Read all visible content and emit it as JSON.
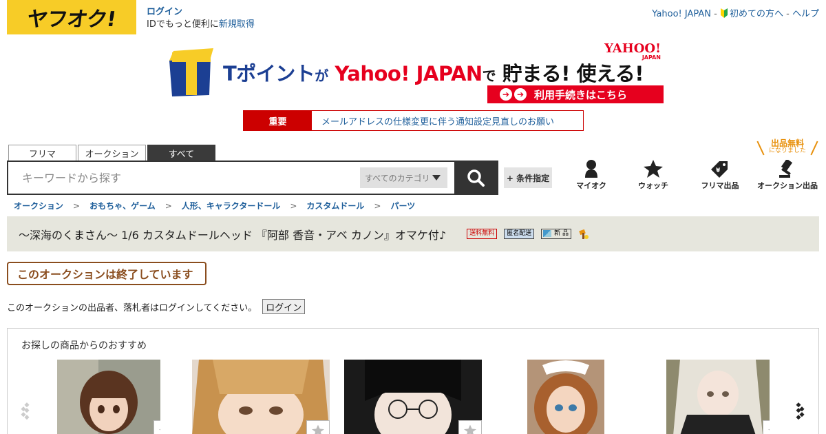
{
  "header": {
    "logo_text": "ヤフオク!",
    "login_label": "ログイン",
    "id_text": "IDでもっと便利に",
    "register_label": "新規取得",
    "links": {
      "yahoo_japan": "Yahoo! JAPAN",
      "sep1": " - ",
      "beginners": "初めての方へ",
      "sep2": " - ",
      "help": "ヘルプ"
    }
  },
  "banner": {
    "t_letter": "T",
    "text_tpoint": "Tポイント",
    "text_ga": "が",
    "text_yahoo": "Yahoo! JAPAN",
    "text_de": "で",
    "text_tamaru": "貯まる! 使える!",
    "yahoo_logo": "YAHOO!",
    "yahoo_logo_sub": "JAPAN",
    "cta": "利用手続きはこちら"
  },
  "notice": {
    "tag": "重要",
    "message": "メールアドレスの仕様変更に伴う通知設定見直しのお願い"
  },
  "search": {
    "tabs": [
      {
        "label": "フリマ"
      },
      {
        "label": "オークション"
      },
      {
        "label": "すべて"
      }
    ],
    "placeholder": "キーワードから探す",
    "category": "すべてのカテゴリ",
    "condition_button": "+ 条件指定"
  },
  "nav": {
    "myauction": "マイオク",
    "watch": "ウォッチ",
    "flea_listing": "フリマ出品",
    "auction_listing": "オークション出品",
    "free_listing": "出品無料",
    "free_listing_sub": "になりました"
  },
  "breadcrumb": [
    "オークション",
    "おもちゃ、ゲーム",
    "人形、キャラクタードール",
    "カスタムドール",
    "パーツ"
  ],
  "breadcrumb_sep": ">",
  "item": {
    "title": "～深海のくまさん～ 1/6 カスタムドールヘッド 『阿部 香音・アベ カノン』オマケ付♪",
    "badges": {
      "free_shipping": "送料無料",
      "anonymous": "匿名配送",
      "new": "新 品"
    }
  },
  "status": {
    "ended": "このオークションは終了しています",
    "login_prompt": "このオークションの出品者、落札者はログインしてください。",
    "login_button": "ログイン"
  },
  "recommendations": {
    "title": "お探しの商品からのおすすめ",
    "items": [
      {
        "label": "doll-1"
      },
      {
        "label": "doll-2"
      },
      {
        "label": "doll-3"
      },
      {
        "label": "doll-4"
      },
      {
        "label": "doll-5"
      }
    ]
  },
  "colors": {
    "brand_yellow": "#f7cc27",
    "link_blue": "#1f5f9b",
    "alert_red": "#cc0000",
    "ended_brown": "#8a4d1e"
  }
}
